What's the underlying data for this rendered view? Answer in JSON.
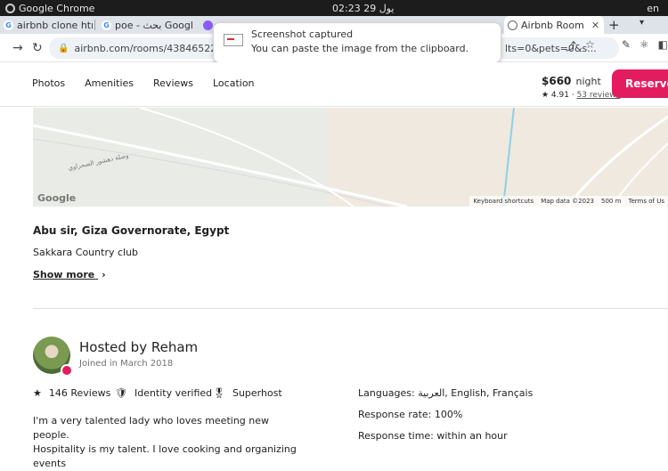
{
  "os": {
    "app_name": "Google Chrome",
    "clock": "02:23  29 يول",
    "lang": "en"
  },
  "tabs": [
    {
      "title": "airbnb clone htm",
      "icon": "google-icon"
    },
    {
      "title": "poe - بحث Googl",
      "icon": "google-icon"
    },
    {
      "title": "",
      "icon": "poe-icon"
    },
    {
      "title": "Airbnb Room",
      "icon": "airbnb-icon"
    }
  ],
  "address_bar": {
    "url_left": "airbnb.com/rooms/43846522?adults=1&",
    "url_right": "lts=0&pets=0&s..."
  },
  "notification": {
    "title": "Screenshot captured",
    "body": "You can paste the image from the clipboard."
  },
  "subnav": [
    "Photos",
    "Amenities",
    "Reviews",
    "Location"
  ],
  "booking": {
    "price": "$660",
    "per": "night",
    "rating": "★ 4.91 ·",
    "reviews": "53 reviews",
    "reserve": "Reserve",
    "accent": "#e31c5f"
  },
  "map": {
    "logo": "Google",
    "footer": [
      "Keyboard shortcuts",
      "Map data ©2023",
      "500 m",
      "Terms of Us"
    ]
  },
  "location": {
    "title": "Abu sir, Giza Governorate, Egypt",
    "subtitle": "Sakkara Country club",
    "show_more": "Show more"
  },
  "host": {
    "title": "Hosted by Reham",
    "joined": "Joined in March 2018",
    "stats": [
      "146 Reviews",
      "Identity verified",
      "Superhost"
    ],
    "languages": "Languages: العربية, English, Français",
    "response_rate": "Response rate: 100%",
    "response_time": "Response time: within an hour",
    "desc_line1": "I'm a very talented lady who loves meeting new people.",
    "desc_line2": "Hospitality is my talent. I love cooking and organizing events"
  }
}
